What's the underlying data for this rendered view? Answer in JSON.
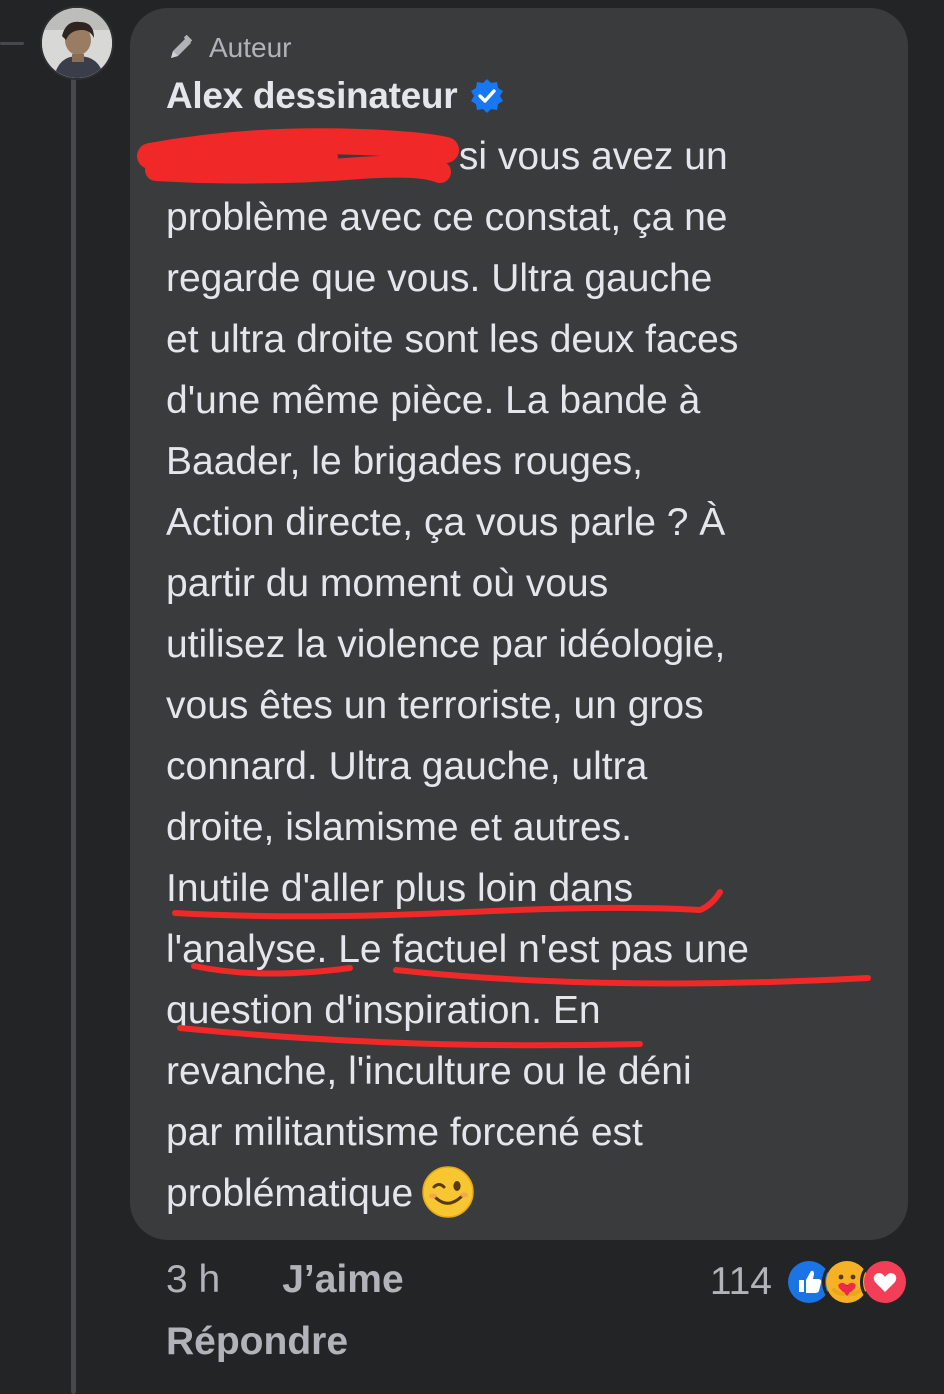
{
  "comment": {
    "author_tag": "Auteur",
    "author_name": "Alex dessinateur",
    "text_first_line": " si vous avez un",
    "text_body": "problème avec ce constat, ça ne\nregarde que vous. Ultra gauche\net ultra droite sont les deux faces\nd'une même pièce. La bande à\nBaader, le brigades rouges,\nAction directe, ça vous parle ? À\npartir du moment où vous\nutilisez la violence par idéologie,\nvous êtes un terroriste, un gros\nconnard. Ultra gauche, ultra\ndroite, islamisme et autres.\nInutile d'aller plus loin dans\nl'analyse. Le factuel n'est pas une\nquestion d'inspiration. En\nrevanche, l'inculture ou le déni\npar militantisme forcené est\nproblématique",
    "emoji": "winking-face"
  },
  "meta": {
    "time": "3 h",
    "like_label": "J’aime",
    "reply_label": "Répondre"
  },
  "reactions": {
    "count": "114",
    "types": [
      "like",
      "care",
      "love"
    ]
  },
  "colors": {
    "background": "#232426",
    "bubble": "#3a3b3c",
    "text": "#e4e6eb",
    "muted": "#b0b3b8",
    "verified": "#1877f2",
    "marker_red": "#f02828"
  }
}
